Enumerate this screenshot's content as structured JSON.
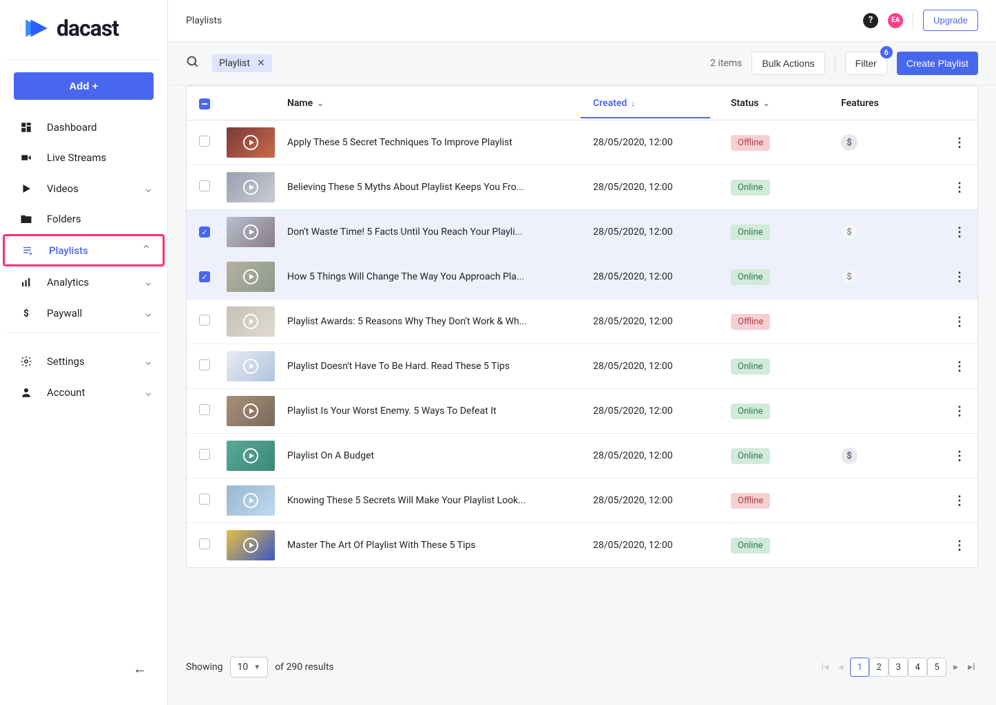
{
  "brand": "dacast",
  "header": {
    "title": "Playlists",
    "avatar_initials": "EA",
    "upgrade_label": "Upgrade"
  },
  "sidebar": {
    "add_label": "Add +",
    "items": [
      {
        "label": "Dashboard",
        "icon": "dashboard-icon",
        "expandable": false
      },
      {
        "label": "Live Streams",
        "icon": "camera-icon",
        "expandable": false
      },
      {
        "label": "Videos",
        "icon": "play-icon",
        "expandable": true
      },
      {
        "label": "Folders",
        "icon": "folder-icon",
        "expandable": false
      },
      {
        "label": "Playlists",
        "icon": "playlist-icon",
        "expandable": true,
        "active": true,
        "expanded": true
      },
      {
        "label": "Analytics",
        "icon": "analytics-icon",
        "expandable": true
      },
      {
        "label": "Paywall",
        "icon": "dollar-icon",
        "expandable": true
      }
    ],
    "footer_items": [
      {
        "label": "Settings",
        "icon": "gear-icon",
        "expandable": true
      },
      {
        "label": "Account",
        "icon": "person-icon",
        "expandable": true
      }
    ]
  },
  "toolbar": {
    "chip_label": "Playlist",
    "items_count": "2 items",
    "bulk_label": "Bulk Actions",
    "filter_label": "Filter",
    "filter_badge": "6",
    "create_label": "Create Playlist"
  },
  "table": {
    "columns": {
      "name": "Name",
      "created": "Created",
      "status": "Status",
      "features": "Features"
    },
    "rows": [
      {
        "name": "Apply These 5 Secret Techniques To Improve Playlist",
        "created": "28/05/2020, 12:00",
        "status": "Offline",
        "feature": "dollar",
        "selected": false
      },
      {
        "name": "Believing These 5 Myths About Playlist Keeps You Fro...",
        "created": "28/05/2020, 12:00",
        "status": "Online",
        "feature": null,
        "selected": false
      },
      {
        "name": "Don't Waste Time! 5 Facts Until You Reach Your Playli...",
        "created": "28/05/2020, 12:00",
        "status": "Online",
        "feature": "dollar-light",
        "selected": true
      },
      {
        "name": "How 5 Things Will Change The Way You Approach Pla...",
        "created": "28/05/2020, 12:00",
        "status": "Online",
        "feature": "dollar-light",
        "selected": true
      },
      {
        "name": "Playlist Awards: 5 Reasons Why They Don't Work & Wh...",
        "created": "28/05/2020, 12:00",
        "status": "Offline",
        "feature": null,
        "selected": false
      },
      {
        "name": "Playlist Doesn't Have To Be Hard. Read These 5 Tips",
        "created": "28/05/2020, 12:00",
        "status": "Online",
        "feature": null,
        "selected": false
      },
      {
        "name": "Playlist Is Your Worst Enemy. 5 Ways To Defeat It",
        "created": "28/05/2020, 12:00",
        "status": "Online",
        "feature": null,
        "selected": false
      },
      {
        "name": "Playlist On A Budget",
        "created": "28/05/2020, 12:00",
        "status": "Online",
        "feature": "dollar",
        "selected": false
      },
      {
        "name": "Knowing These 5 Secrets Will Make Your Playlist Look...",
        "created": "28/05/2020, 12:00",
        "status": "Offline",
        "feature": null,
        "selected": false
      },
      {
        "name": "Master The Art Of Playlist With These 5 Tips",
        "created": "28/05/2020, 12:00",
        "status": "Online",
        "feature": null,
        "selected": false
      }
    ]
  },
  "pagination": {
    "showing_label": "Showing",
    "page_size": "10",
    "of_label": "of 290 results",
    "pages": [
      "1",
      "2",
      "3",
      "4",
      "5"
    ],
    "current": "1"
  }
}
